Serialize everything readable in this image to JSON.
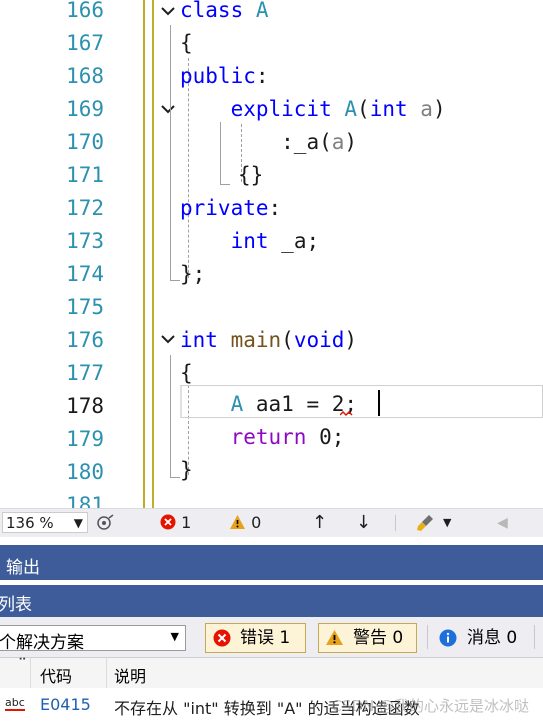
{
  "editor": {
    "line_numbers": [
      "166",
      "167",
      "168",
      "169",
      "170",
      "171",
      "172",
      "173",
      "174",
      "175",
      "176",
      "177",
      "178",
      "179",
      "180",
      "181"
    ],
    "lines": {
      "l166": {
        "kw": "class",
        "ty": "A"
      },
      "l167": "{",
      "l168": {
        "kw": "public",
        "rest": ":"
      },
      "l169": {
        "kw": "explicit",
        "ty": "A",
        "p1": "(",
        "t2": "int",
        "pa": "a",
        "p2": ")"
      },
      "l170": {
        "t1": ":_a(",
        "pa": "a",
        "t2": ")"
      },
      "l171": "{}",
      "l172": {
        "kw": "private",
        "rest": ":"
      },
      "l173": {
        "kw": "int",
        "rest": "_a;"
      },
      "l174": "};",
      "l176": {
        "kw": "int",
        "fn": "main",
        "p1": "(",
        "kw2": "void",
        "p2": ")"
      },
      "l177": "{",
      "l178": {
        "ty": "A",
        "rest": "aa1 = 2;"
      },
      "l179": {
        "kw": "return",
        "rest": "0;"
      },
      "l180": "}"
    }
  },
  "statusbar": {
    "zoom": "136 %",
    "errors": "1",
    "warnings": "0"
  },
  "output_tab": {
    "label": "输出"
  },
  "error_list": {
    "title": "列表",
    "scope": "个解决方案",
    "errors_label": "错误 1",
    "warnings_label": "警告 0",
    "messages_label": "消息 0",
    "columns": [
      "代码",
      "说明"
    ],
    "rows": [
      {
        "code": "E0415",
        "description": "不存在从 \"int\" 转换到 \"A\" 的适当构造函数",
        "icon_text": "abc"
      }
    ]
  },
  "watermark": "CSDN @我的心永远是冰冰哒"
}
